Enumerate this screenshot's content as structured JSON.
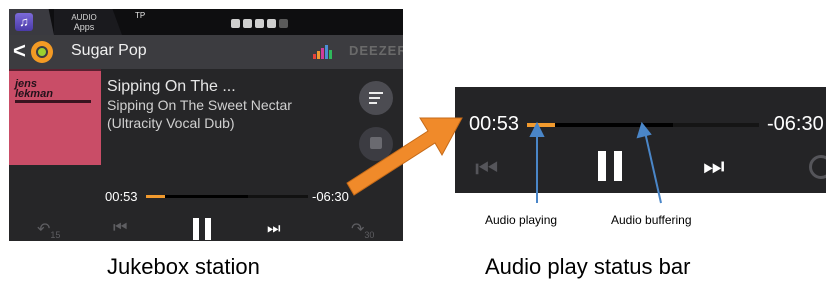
{
  "status_bar": {
    "audio_apps_line1": "AUDIO",
    "audio_apps_line2": "Apps",
    "tp": "TP"
  },
  "header": {
    "station_name": "Sugar Pop",
    "service_logo": "DEEZER"
  },
  "album_art": {
    "artist_text_1": "jens",
    "artist_text_2": "lekman"
  },
  "track": {
    "title_short": "Sipping On The ...",
    "title_full": "Sipping On The Sweet Nectar",
    "version": "(Ultracity Vocal Dub)"
  },
  "progress": {
    "elapsed": "00:53",
    "remaining": "-06:30",
    "played_fraction": 0.12,
    "buffered_fraction": 0.63
  },
  "controls": {
    "rewind_label": "15",
    "forward_label": "30"
  },
  "annotations": {
    "playing": "Audio playing",
    "buffering": "Audio buffering"
  },
  "captions": {
    "left": "Jukebox station",
    "right": "Audio play status bar"
  },
  "colors": {
    "played": "#f19a2e",
    "buffered": "#000000",
    "callout_arrow": "#f08a2a",
    "pointer_arrow": "#4a86c8"
  }
}
